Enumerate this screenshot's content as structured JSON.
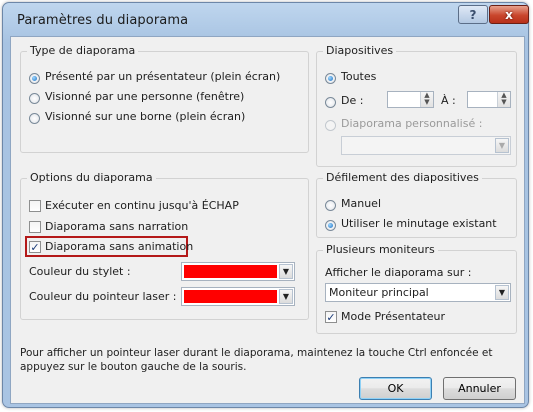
{
  "window": {
    "title": "Paramètres du diaporama",
    "help_label": "?",
    "close_label": "x"
  },
  "type_group": {
    "title": "Type de diaporama",
    "options": [
      {
        "label": "Présenté par un présentateur (plein écran)",
        "checked": true
      },
      {
        "label": "Visionné par une personne (fenêtre)",
        "checked": false
      },
      {
        "label": "Visionné sur une borne (plein écran)",
        "checked": false
      }
    ]
  },
  "slides_group": {
    "title": "Diapositives",
    "all_label": "Toutes",
    "from_label": "De :",
    "to_label": "À :",
    "from_value": "",
    "to_value": "",
    "custom_label": "Diaporama personnalisé :",
    "custom_value": ""
  },
  "options_group": {
    "title": "Options du diaporama",
    "checkboxes": [
      {
        "label": "Exécuter en continu jusqu'à ÉCHAP",
        "checked": false
      },
      {
        "label": "Diaporama sans narration",
        "checked": false
      },
      {
        "label": "Diaporama sans animation",
        "checked": true
      }
    ],
    "pen_color_label": "Couleur du stylet :",
    "laser_color_label": "Couleur du pointeur laser :",
    "pen_color": "#ff0000",
    "laser_color": "#ff0000"
  },
  "advance_group": {
    "title": "Défilement des diapositives",
    "options": [
      {
        "label": "Manuel",
        "checked": false
      },
      {
        "label": "Utiliser le minutage existant",
        "checked": true
      }
    ]
  },
  "monitors_group": {
    "title": "Plusieurs moniteurs",
    "display_label": "Afficher le diaporama sur :",
    "display_value": "Moniteur principal",
    "presenter_view_label": "Mode Présentateur",
    "presenter_view_checked": true
  },
  "hint": "Pour afficher un pointeur laser durant le diaporama, maintenez la touche Ctrl enfoncée et appuyez sur le bouton gauche de la souris.",
  "buttons": {
    "ok_label": "OK",
    "cancel_label": "Annuler"
  },
  "icons": {
    "check": "✓",
    "dropdown": "▼",
    "spin_up": "▲",
    "spin_down": "▼"
  },
  "colors": {
    "highlight_border": "#b41919",
    "radio_selected": "#1c6fc2"
  }
}
